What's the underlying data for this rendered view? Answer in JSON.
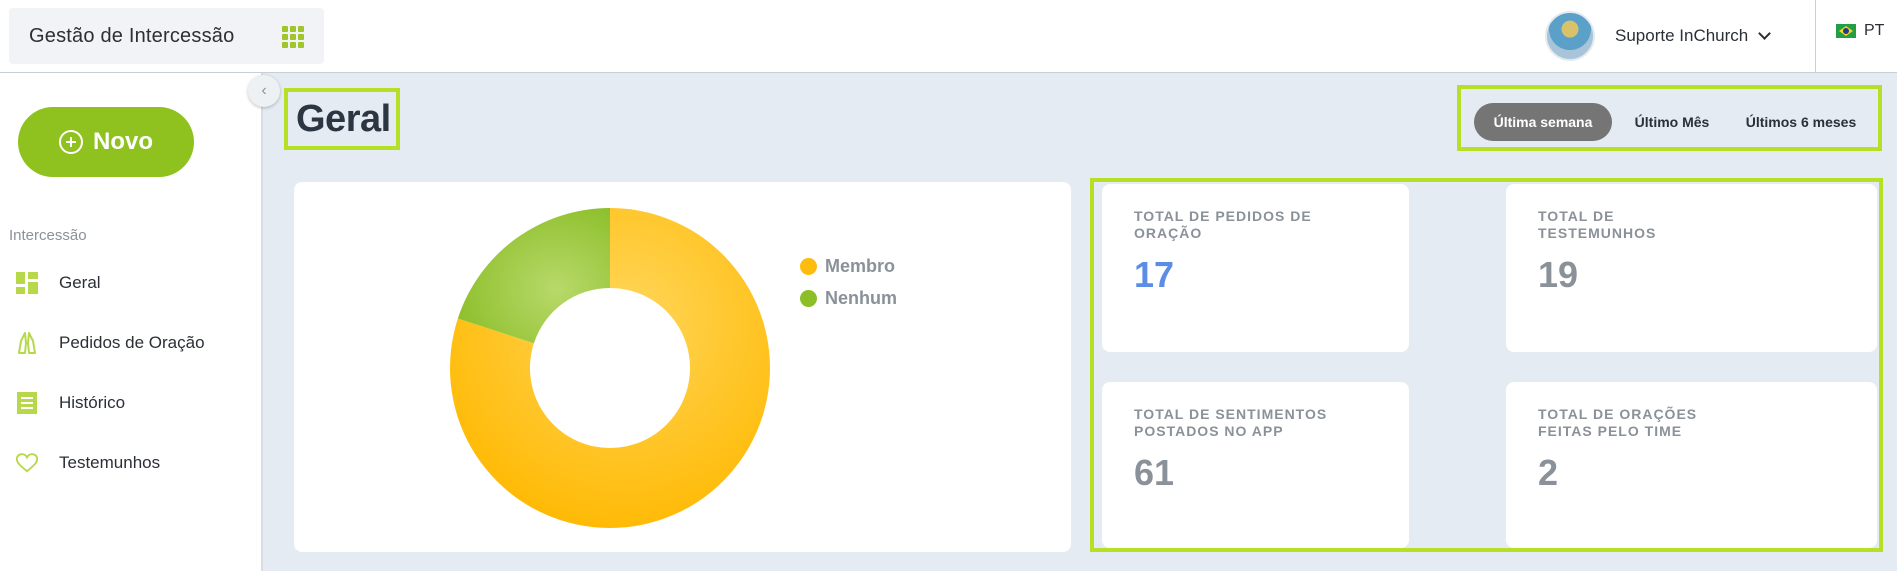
{
  "header": {
    "module_title": "Gestão de Intercessão",
    "apps_icon": "grid-apps-icon",
    "user_name": "Suporte InChurch",
    "language": "PT"
  },
  "sidebar": {
    "new_button": "Novo",
    "section": "Intercessão",
    "items": [
      {
        "label": "Geral",
        "icon": "dashboard-icon"
      },
      {
        "label": "Pedidos de Oração",
        "icon": "praying-hands-icon"
      },
      {
        "label": "Histórico",
        "icon": "list-document-icon"
      },
      {
        "label": "Testemunhos",
        "icon": "heart-icon"
      }
    ]
  },
  "main": {
    "title": "Geral",
    "periods": [
      {
        "label": "Última semana",
        "active": true
      },
      {
        "label": "Último Mês",
        "active": false
      },
      {
        "label": "Últimos 6 meses",
        "active": false
      }
    ],
    "stats": [
      {
        "label": "TOTAL DE PEDIDOS DE ORAÇÃO",
        "value": "17"
      },
      {
        "label": "TOTAL DE TESTEMUNHOS",
        "value": "19"
      },
      {
        "label": "TOTAL DE SENTIMENTOS POSTADOS NO APP",
        "value": "61"
      },
      {
        "label": "TOTAL DE ORAÇÕES FEITAS PELO TIME",
        "value": "2"
      }
    ]
  },
  "colors": {
    "accent_green": "#8fc21f",
    "highlight_border": "#b6e026",
    "membro": "#ffbc0d",
    "nenhum": "#8cbf26",
    "stat_blue": "#5b8de5"
  },
  "chart_data": {
    "type": "pie",
    "donut": true,
    "legend_position": "right",
    "labels": [
      "Membro",
      "Nenhum"
    ],
    "values": [
      80,
      20
    ],
    "colors": [
      "#ffbc0d",
      "#8cbf26"
    ]
  }
}
